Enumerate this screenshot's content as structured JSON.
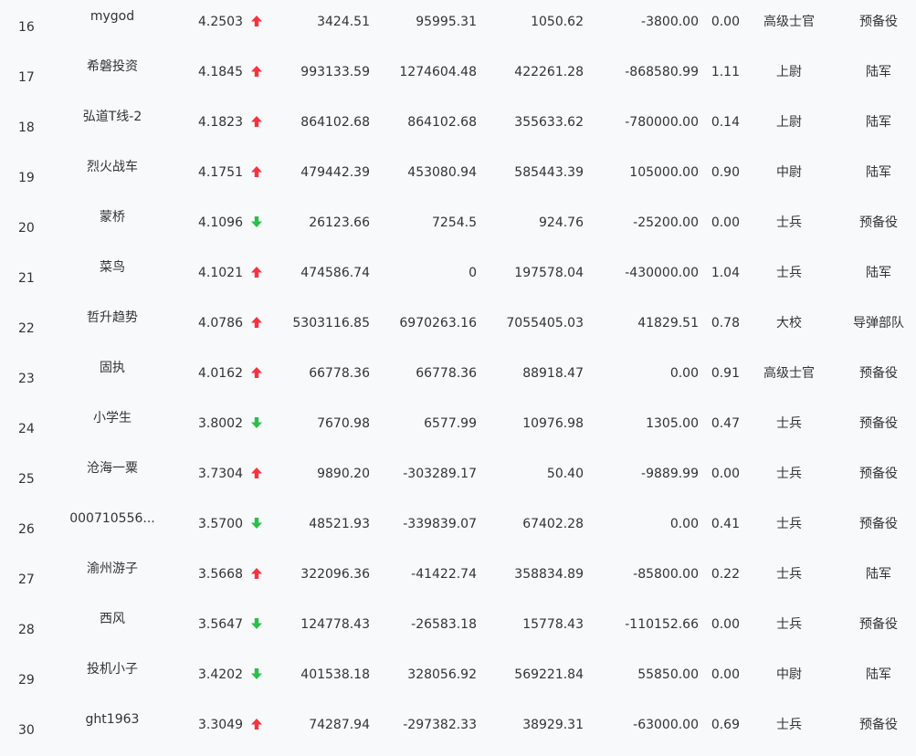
{
  "colors": {
    "up": "#f5333f",
    "down": "#2bbf4a",
    "background": "#f8f9fb",
    "text": "#333333"
  },
  "rows": [
    {
      "rank": "16",
      "name": "mygod",
      "score": "4.2503",
      "trend": "up",
      "v1": "3424.51",
      "v2": "95995.31",
      "v3": "1050.62",
      "v4": "-3800.00",
      "v5": "0.00",
      "rank_title": "高级士官",
      "branch": "预备役"
    },
    {
      "rank": "17",
      "name": "希磐投资",
      "score": "4.1845",
      "trend": "up",
      "v1": "993133.59",
      "v2": "1274604.48",
      "v3": "422261.28",
      "v4": "-868580.99",
      "v5": "1.11",
      "rank_title": "上尉",
      "branch": "陆军"
    },
    {
      "rank": "18",
      "name": "弘道T线-2",
      "score": "4.1823",
      "trend": "up",
      "v1": "864102.68",
      "v2": "864102.68",
      "v3": "355633.62",
      "v4": "-780000.00",
      "v5": "0.14",
      "rank_title": "上尉",
      "branch": "陆军"
    },
    {
      "rank": "19",
      "name": "烈火战车",
      "score": "4.1751",
      "trend": "up",
      "v1": "479442.39",
      "v2": "453080.94",
      "v3": "585443.39",
      "v4": "105000.00",
      "v5": "0.90",
      "rank_title": "中尉",
      "branch": "陆军"
    },
    {
      "rank": "20",
      "name": "蒙桥",
      "score": "4.1096",
      "trend": "down",
      "v1": "26123.66",
      "v2": "7254.5",
      "v3": "924.76",
      "v4": "-25200.00",
      "v5": "0.00",
      "rank_title": "士兵",
      "branch": "预备役"
    },
    {
      "rank": "21",
      "name": "菜鸟",
      "score": "4.1021",
      "trend": "up",
      "v1": "474586.74",
      "v2": "0",
      "v3": "197578.04",
      "v4": "-430000.00",
      "v5": "1.04",
      "rank_title": "士兵",
      "branch": "陆军"
    },
    {
      "rank": "22",
      "name": "哲升趋势",
      "score": "4.0786",
      "trend": "up",
      "v1": "5303116.85",
      "v2": "6970263.16",
      "v3": "7055405.03",
      "v4": "41829.51",
      "v5": "0.78",
      "rank_title": "大校",
      "branch": "导弹部队"
    },
    {
      "rank": "23",
      "name": "固执",
      "score": "4.0162",
      "trend": "up",
      "v1": "66778.36",
      "v2": "66778.36",
      "v3": "88918.47",
      "v4": "0.00",
      "v5": "0.91",
      "rank_title": "高级士官",
      "branch": "预备役"
    },
    {
      "rank": "24",
      "name": "小学生",
      "score": "3.8002",
      "trend": "down",
      "v1": "7670.98",
      "v2": "6577.99",
      "v3": "10976.98",
      "v4": "1305.00",
      "v5": "0.47",
      "rank_title": "士兵",
      "branch": "预备役"
    },
    {
      "rank": "25",
      "name": "沧海一粟",
      "score": "3.7304",
      "trend": "up",
      "v1": "9890.20",
      "v2": "-303289.17",
      "v3": "50.40",
      "v4": "-9889.99",
      "v5": "0.00",
      "rank_title": "士兵",
      "branch": "预备役"
    },
    {
      "rank": "26",
      "name": "000710556...",
      "score": "3.5700",
      "trend": "down",
      "v1": "48521.93",
      "v2": "-339839.07",
      "v3": "67402.28",
      "v4": "0.00",
      "v5": "0.41",
      "rank_title": "士兵",
      "branch": "预备役"
    },
    {
      "rank": "27",
      "name": "渝州游子",
      "score": "3.5668",
      "trend": "up",
      "v1": "322096.36",
      "v2": "-41422.74",
      "v3": "358834.89",
      "v4": "-85800.00",
      "v5": "0.22",
      "rank_title": "士兵",
      "branch": "陆军"
    },
    {
      "rank": "28",
      "name": "西风",
      "score": "3.5647",
      "trend": "down",
      "v1": "124778.43",
      "v2": "-26583.18",
      "v3": "15778.43",
      "v4": "-110152.66",
      "v5": "0.00",
      "rank_title": "士兵",
      "branch": "预备役"
    },
    {
      "rank": "29",
      "name": "投机小子",
      "score": "3.4202",
      "trend": "down",
      "v1": "401538.18",
      "v2": "328056.92",
      "v3": "569221.84",
      "v4": "55850.00",
      "v5": "0.00",
      "rank_title": "中尉",
      "branch": "陆军"
    },
    {
      "rank": "30",
      "name": "ght1963",
      "score": "3.3049",
      "trend": "up",
      "v1": "74287.94",
      "v2": "-297382.33",
      "v3": "38929.31",
      "v4": "-63000.00",
      "v5": "0.69",
      "rank_title": "士兵",
      "branch": "预备役"
    }
  ]
}
